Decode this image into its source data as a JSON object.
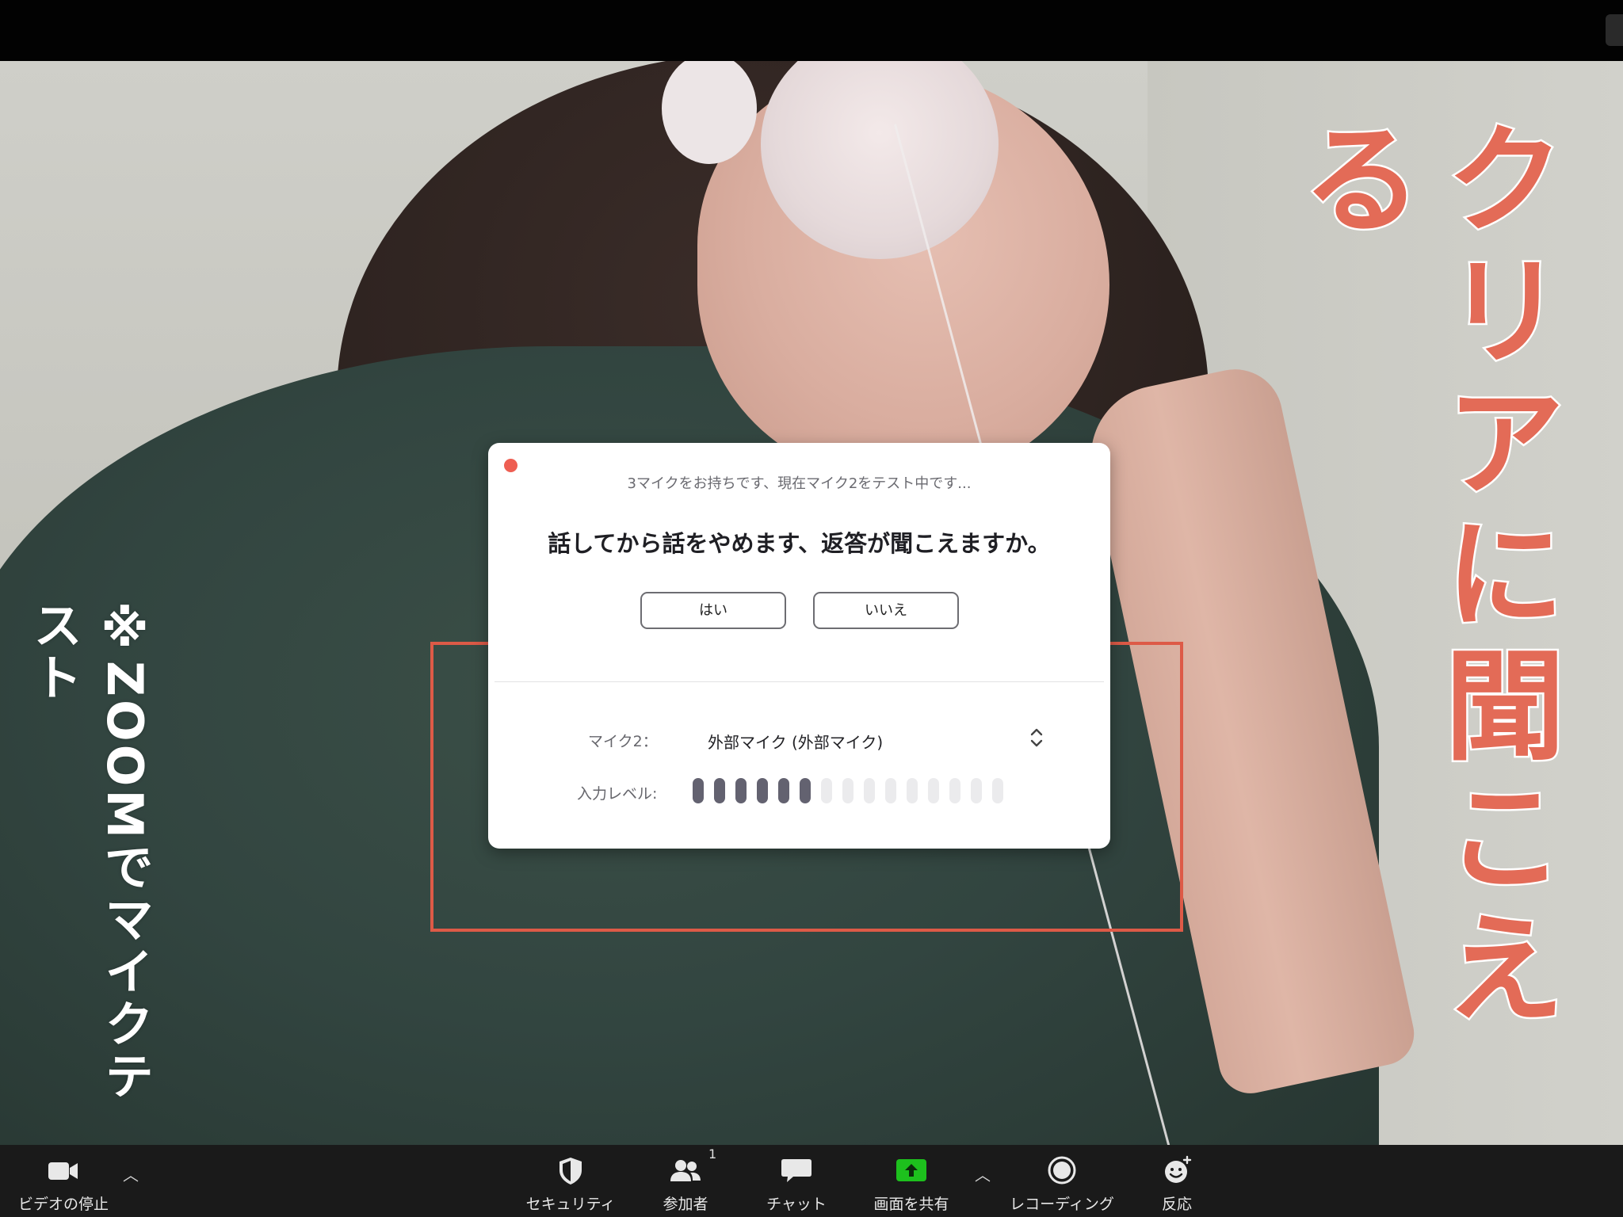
{
  "captions": {
    "left": "※ZOOMでマイクテスト",
    "right": "クリアに聞こえる"
  },
  "dialog": {
    "subtitle": "3マイクをお持ちです、現在マイク2をテスト中です...",
    "question": "話してから話をやめます、返答が聞こえますか。",
    "yes_label": "はい",
    "no_label": "いいえ",
    "mic_label": "マイク2：",
    "mic_value": "外部マイク (外部マイク)",
    "level_label": "入力レベル:",
    "level": {
      "active": 6,
      "total": 15
    }
  },
  "toolbar": {
    "video_label": "ビデオの停止",
    "security_label": "セキュリティ",
    "participants_label": "参加者",
    "participants_count": "1",
    "chat_label": "チャット",
    "share_label": "画面を共有",
    "record_label": "レコーディング",
    "reactions_label": "反応"
  },
  "colors": {
    "highlight": "#dd5a47",
    "caption_right": "#e36b57",
    "share_green": "#1dc01d",
    "level_active": "#636270",
    "level_inactive": "#ebebed",
    "close_dot": "#ee5e52"
  },
  "icons": [
    "video-camera-icon",
    "security-shield-icon",
    "participants-icon",
    "chat-bubble-icon",
    "share-screen-icon",
    "record-icon",
    "reaction-icon",
    "chevron-up-icon",
    "stepper-icon",
    "close-dot-icon"
  ]
}
